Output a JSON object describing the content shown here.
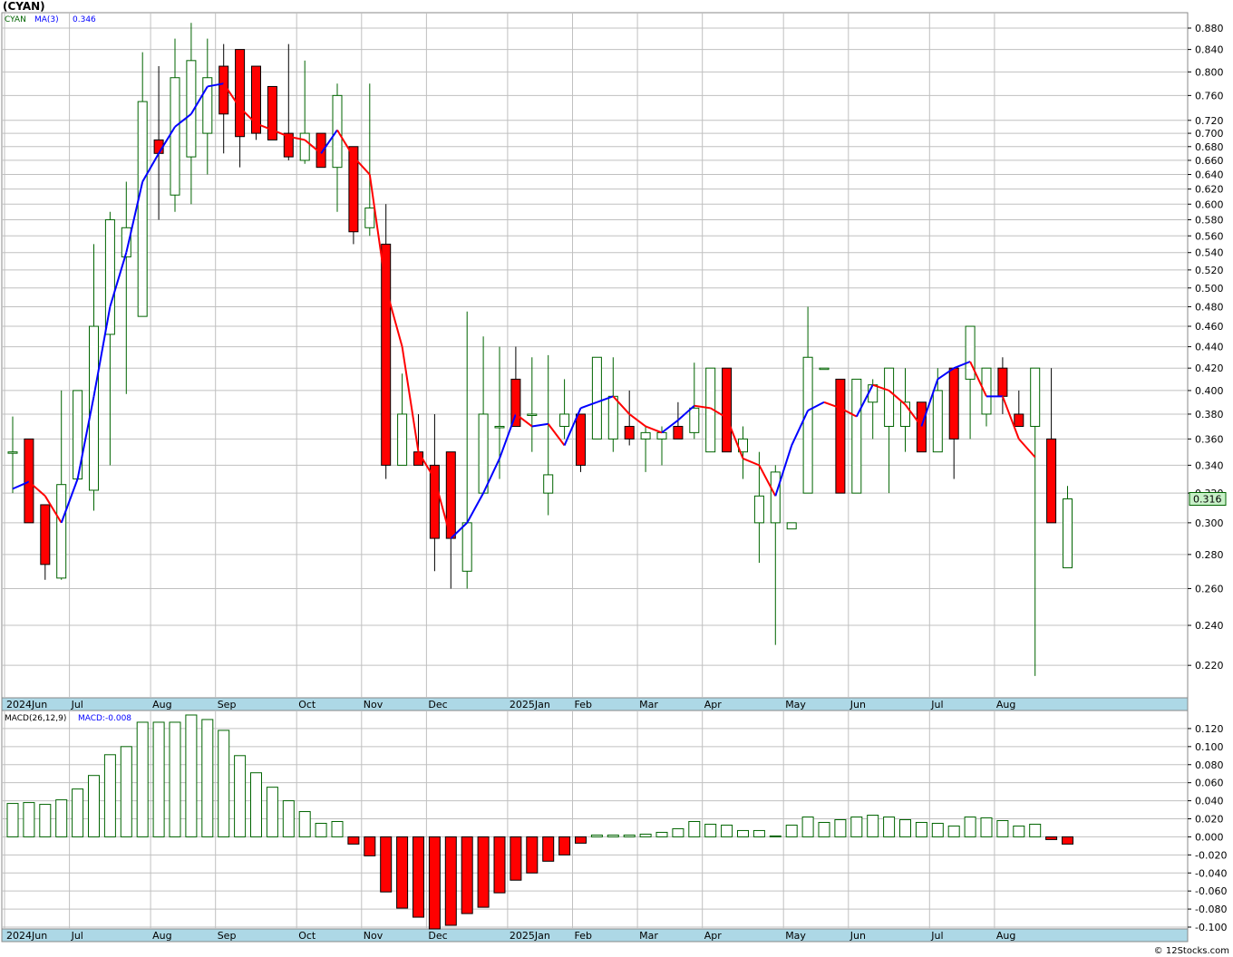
{
  "ticker_title": "(CYAN)",
  "credit": "© 12Stocks.com",
  "colors": {
    "up": "#006400",
    "down": "#ff0000",
    "ma_up": "#0000ff",
    "ma_down": "#ff0000",
    "grid": "#c0c0c0",
    "band": "#add8e6",
    "last_bg": "#c8f0c8"
  },
  "chart_data": [
    {
      "type": "candlestick",
      "title": "",
      "legend": [
        "CYAN",
        "MA(3)",
        "0.346"
      ],
      "last_price_label": "0.316",
      "x_labels": [
        {
          "label": "2024Jun",
          "index": 0
        },
        {
          "label": "Jul",
          "index": 4
        },
        {
          "label": "Aug",
          "index": 9
        },
        {
          "label": "Sep",
          "index": 13
        },
        {
          "label": "Oct",
          "index": 18
        },
        {
          "label": "Nov",
          "index": 22
        },
        {
          "label": "Dec",
          "index": 26
        },
        {
          "label": "2025Jan",
          "index": 31
        },
        {
          "label": "Feb",
          "index": 35
        },
        {
          "label": "Mar",
          "index": 39
        },
        {
          "label": "Apr",
          "index": 43
        },
        {
          "label": "May",
          "index": 48
        },
        {
          "label": "Jun",
          "index": 52
        },
        {
          "label": "Jul",
          "index": 57
        },
        {
          "label": "Aug",
          "index": 61
        }
      ],
      "y_scale": "log",
      "y_ticks": [
        "0.220",
        "0.240",
        "0.260",
        "0.280",
        "0.300",
        "0.320",
        "0.340",
        "0.360",
        "0.380",
        "0.400",
        "0.420",
        "0.440",
        "0.460",
        "0.480",
        "0.500",
        "0.520",
        "0.540",
        "0.560",
        "0.580",
        "0.600",
        "0.620",
        "0.640",
        "0.660",
        "0.680",
        "0.700",
        "0.720",
        "0.760",
        "0.800",
        "0.840",
        "0.880"
      ],
      "ylim": [
        0.205,
        0.91
      ],
      "candles": [
        {
          "o": 0.35,
          "h": 0.378,
          "l": 0.32,
          "c": 0.35
        },
        {
          "o": 0.36,
          "h": 0.36,
          "l": 0.3,
          "c": 0.3
        },
        {
          "o": 0.312,
          "h": 0.312,
          "l": 0.265,
          "c": 0.274
        },
        {
          "o": 0.266,
          "h": 0.4,
          "l": 0.265,
          "c": 0.326
        },
        {
          "o": 0.33,
          "h": 0.4,
          "l": 0.33,
          "c": 0.4
        },
        {
          "o": 0.322,
          "h": 0.55,
          "l": 0.308,
          "c": 0.46
        },
        {
          "o": 0.452,
          "h": 0.59,
          "l": 0.34,
          "c": 0.58
        },
        {
          "o": 0.535,
          "h": 0.63,
          "l": 0.397,
          "c": 0.57
        },
        {
          "o": 0.47,
          "h": 0.835,
          "l": 0.47,
          "c": 0.75
        },
        {
          "o": 0.69,
          "h": 0.81,
          "l": 0.58,
          "c": 0.67
        },
        {
          "o": 0.612,
          "h": 0.86,
          "l": 0.59,
          "c": 0.79
        },
        {
          "o": 0.665,
          "h": 0.89,
          "l": 0.6,
          "c": 0.82
        },
        {
          "o": 0.7,
          "h": 0.86,
          "l": 0.64,
          "c": 0.79
        },
        {
          "o": 0.81,
          "h": 0.85,
          "l": 0.67,
          "c": 0.73
        },
        {
          "o": 0.84,
          "h": 0.84,
          "l": 0.65,
          "c": 0.695
        },
        {
          "o": 0.81,
          "h": 0.81,
          "l": 0.69,
          "c": 0.7
        },
        {
          "o": 0.775,
          "h": 0.775,
          "l": 0.69,
          "c": 0.69
        },
        {
          "o": 0.7,
          "h": 0.85,
          "l": 0.66,
          "c": 0.665
        },
        {
          "o": 0.66,
          "h": 0.82,
          "l": 0.655,
          "c": 0.7
        },
        {
          "o": 0.7,
          "h": 0.7,
          "l": 0.65,
          "c": 0.65
        },
        {
          "o": 0.65,
          "h": 0.78,
          "l": 0.59,
          "c": 0.76
        },
        {
          "o": 0.68,
          "h": 0.68,
          "l": 0.55,
          "c": 0.565
        },
        {
          "o": 0.57,
          "h": 0.78,
          "l": 0.56,
          "c": 0.595
        },
        {
          "o": 0.55,
          "h": 0.6,
          "l": 0.33,
          "c": 0.34
        },
        {
          "o": 0.34,
          "h": 0.415,
          "l": 0.34,
          "c": 0.38
        },
        {
          "o": 0.35,
          "h": 0.38,
          "l": 0.34,
          "c": 0.34
        },
        {
          "o": 0.34,
          "h": 0.38,
          "l": 0.27,
          "c": 0.29
        },
        {
          "o": 0.35,
          "h": 0.35,
          "l": 0.26,
          "c": 0.29
        },
        {
          "o": 0.27,
          "h": 0.475,
          "l": 0.26,
          "c": 0.3
        },
        {
          "o": 0.32,
          "h": 0.45,
          "l": 0.32,
          "c": 0.38
        },
        {
          "o": 0.37,
          "h": 0.44,
          "l": 0.33,
          "c": 0.37
        },
        {
          "o": 0.41,
          "h": 0.44,
          "l": 0.37,
          "c": 0.37
        },
        {
          "o": 0.38,
          "h": 0.43,
          "l": 0.35,
          "c": 0.38
        },
        {
          "o": 0.32,
          "h": 0.432,
          "l": 0.305,
          "c": 0.333
        },
        {
          "o": 0.37,
          "h": 0.41,
          "l": 0.36,
          "c": 0.38
        },
        {
          "o": 0.38,
          "h": 0.38,
          "l": 0.335,
          "c": 0.34
        },
        {
          "o": 0.36,
          "h": 0.43,
          "l": 0.36,
          "c": 0.43
        },
        {
          "o": 0.36,
          "h": 0.43,
          "l": 0.35,
          "c": 0.395
        },
        {
          "o": 0.37,
          "h": 0.4,
          "l": 0.355,
          "c": 0.36
        },
        {
          "o": 0.36,
          "h": 0.37,
          "l": 0.335,
          "c": 0.365
        },
        {
          "o": 0.36,
          "h": 0.37,
          "l": 0.34,
          "c": 0.365
        },
        {
          "o": 0.37,
          "h": 0.39,
          "l": 0.36,
          "c": 0.36
        },
        {
          "o": 0.365,
          "h": 0.425,
          "l": 0.36,
          "c": 0.385
        },
        {
          "o": 0.35,
          "h": 0.42,
          "l": 0.35,
          "c": 0.42
        },
        {
          "o": 0.42,
          "h": 0.42,
          "l": 0.35,
          "c": 0.35
        },
        {
          "o": 0.35,
          "h": 0.37,
          "l": 0.33,
          "c": 0.36
        },
        {
          "o": 0.3,
          "h": 0.35,
          "l": 0.275,
          "c": 0.318
        },
        {
          "o": 0.3,
          "h": 0.34,
          "l": 0.23,
          "c": 0.335
        },
        {
          "o": 0.296,
          "h": 0.3,
          "l": 0.296,
          "c": 0.3
        },
        {
          "o": 0.32,
          "h": 0.48,
          "l": 0.32,
          "c": 0.43
        },
        {
          "o": 0.42,
          "h": 0.42,
          "l": 0.42,
          "c": 0.42
        },
        {
          "o": 0.41,
          "h": 0.41,
          "l": 0.32,
          "c": 0.32
        },
        {
          "o": 0.32,
          "h": 0.41,
          "l": 0.32,
          "c": 0.41
        },
        {
          "o": 0.39,
          "h": 0.41,
          "l": 0.36,
          "c": 0.405
        },
        {
          "o": 0.37,
          "h": 0.42,
          "l": 0.32,
          "c": 0.42
        },
        {
          "o": 0.37,
          "h": 0.42,
          "l": 0.35,
          "c": 0.39
        },
        {
          "o": 0.39,
          "h": 0.39,
          "l": 0.35,
          "c": 0.35
        },
        {
          "o": 0.35,
          "h": 0.42,
          "l": 0.35,
          "c": 0.4
        },
        {
          "o": 0.42,
          "h": 0.42,
          "l": 0.33,
          "c": 0.36
        },
        {
          "o": 0.41,
          "h": 0.46,
          "l": 0.36,
          "c": 0.46
        },
        {
          "o": 0.38,
          "h": 0.42,
          "l": 0.37,
          "c": 0.42
        },
        {
          "o": 0.42,
          "h": 0.43,
          "l": 0.38,
          "c": 0.395
        },
        {
          "o": 0.38,
          "h": 0.4,
          "l": 0.37,
          "c": 0.37
        },
        {
          "o": 0.37,
          "h": 0.42,
          "l": 0.215,
          "c": 0.42
        },
        {
          "o": 0.36,
          "h": 0.42,
          "l": 0.3,
          "c": 0.3
        },
        {
          "o": 0.272,
          "h": 0.325,
          "l": 0.272,
          "c": 0.316
        }
      ],
      "ma3": [
        0.323,
        0.328,
        0.318,
        0.3,
        0.33,
        0.395,
        0.48,
        0.54,
        0.63,
        0.67,
        0.71,
        0.73,
        0.775,
        0.78,
        0.74,
        0.715,
        0.705,
        0.695,
        0.69,
        0.67,
        0.705,
        0.665,
        0.64,
        0.5,
        0.44,
        0.35,
        0.33,
        0.29,
        0.3,
        0.32,
        0.345,
        0.38,
        0.37,
        0.372,
        0.355,
        0.385,
        0.39,
        0.395,
        0.38,
        0.37,
        0.365,
        0.375,
        0.387,
        0.385,
        0.377,
        0.345,
        0.34,
        0.318,
        0.355,
        0.383,
        0.39,
        0.385,
        0.378,
        0.405,
        0.4,
        0.388,
        0.37,
        0.41,
        0.42,
        0.426,
        0.395,
        0.395,
        0.36,
        0.346
      ]
    },
    {
      "type": "bar",
      "title": "",
      "legend": [
        "MACD(26,12,9)",
        "MACD:-0.008"
      ],
      "y_ticks": [
        "-0.100",
        "-0.080",
        "-0.060",
        "-0.040",
        "-0.020",
        "0.000",
        "0.020",
        "0.040",
        "0.060",
        "0.080",
        "0.100",
        "0.120"
      ],
      "ylim": [
        -0.102,
        0.14
      ],
      "values": [
        0.037,
        0.038,
        0.036,
        0.041,
        0.053,
        0.068,
        0.091,
        0.1,
        0.127,
        0.127,
        0.127,
        0.135,
        0.13,
        0.118,
        0.09,
        0.071,
        0.055,
        0.04,
        0.028,
        0.015,
        0.017,
        -0.008,
        -0.021,
        -0.061,
        -0.079,
        -0.089,
        -0.102,
        -0.098,
        -0.085,
        -0.078,
        -0.062,
        -0.048,
        -0.04,
        -0.027,
        -0.02,
        -0.007,
        0.002,
        0.002,
        0.002,
        0.003,
        0.005,
        0.009,
        0.017,
        0.014,
        0.013,
        0.007,
        0.007,
        0.001,
        0.013,
        0.022,
        0.016,
        0.019,
        0.022,
        0.024,
        0.022,
        0.019,
        0.016,
        0.015,
        0.012,
        0.022,
        0.021,
        0.018,
        0.012,
        0.014,
        -0.003,
        -0.008
      ]
    }
  ]
}
